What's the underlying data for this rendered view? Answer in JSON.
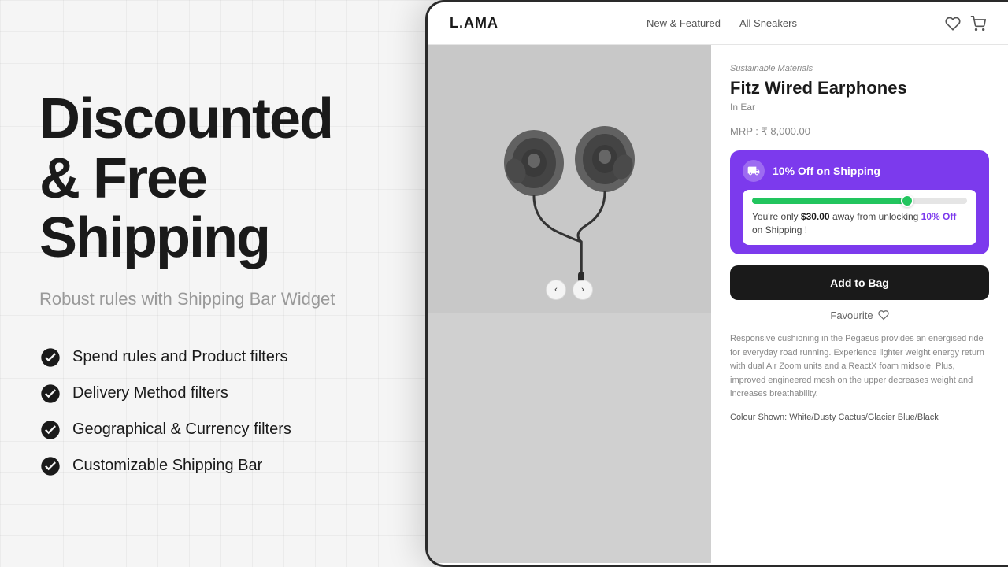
{
  "left": {
    "hero_title": "Discounted & Free Shipping",
    "hero_subtitle": "Robust rules with Shipping Bar Widget",
    "features": [
      {
        "id": "feature-1",
        "text": "Spend rules and Product filters"
      },
      {
        "id": "feature-2",
        "text": "Delivery Method filters"
      },
      {
        "id": "feature-3",
        "text": "Geographical & Currency filters"
      },
      {
        "id": "feature-4",
        "text": "Customizable Shipping Bar"
      }
    ]
  },
  "app": {
    "logo": "L.AMA",
    "nav_links": [
      "New & Featured",
      "All Sneakers"
    ],
    "product": {
      "category": "Sustainable Materials",
      "name": "Fitz Wired Earphones",
      "type": "In Ear",
      "price": "MRP : ₹ 8,000.00",
      "shipping_bar": {
        "title": "10% Off on Shipping",
        "progress_percent": 72,
        "message_prefix": "You're only ",
        "amount": "$30.00",
        "message_mid": " away from unlocking ",
        "discount": "10% Off",
        "message_suffix": " on Shipping !"
      },
      "add_to_bag": "Add to Bag",
      "favourite": "Favourite",
      "description": "Responsive cushioning in the Pegasus provides an energised ride for everyday road running. Experience lighter weight energy return with dual Air Zoom units and a ReactX foam midsole. Plus, improved engineered mesh on the upper decreases weight and increases breathability.",
      "colour_label": "Colour Shown: White/Dusty Cactus/Glacier Blue/Black"
    }
  }
}
